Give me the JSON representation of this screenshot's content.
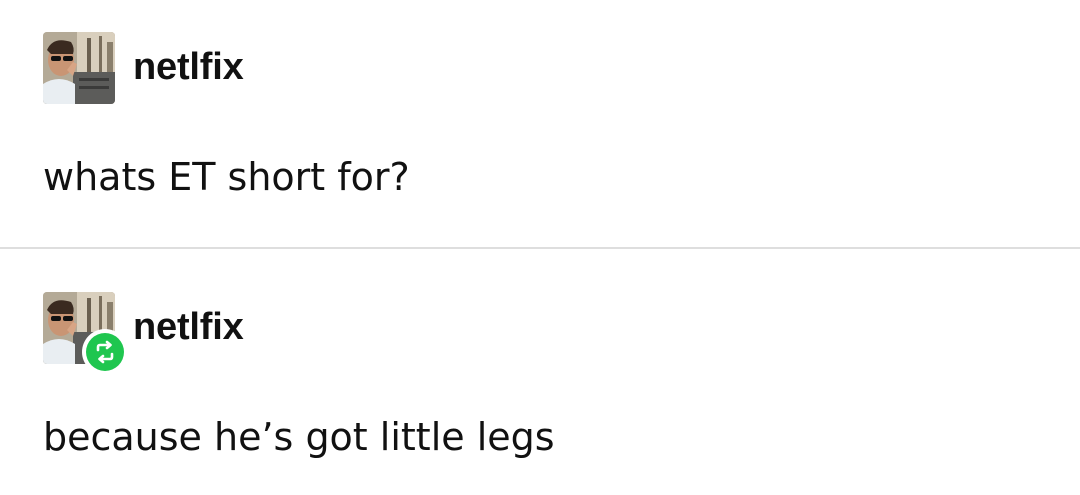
{
  "posts": [
    {
      "username": "netlfix",
      "text": "whats ET short for?",
      "avatar_icon": "user-avatar-photo",
      "reblogged": false
    },
    {
      "username": "netlfix",
      "text": "because he’s got little legs",
      "avatar_icon": "user-avatar-photo",
      "reblogged": true,
      "badge_icon": "reblog-icon",
      "badge_color": "#1fc64f"
    }
  ],
  "colors": {
    "background": "#ffffff",
    "text": "#111111",
    "divider": "#dedede",
    "reblog_green": "#1fc64f"
  }
}
